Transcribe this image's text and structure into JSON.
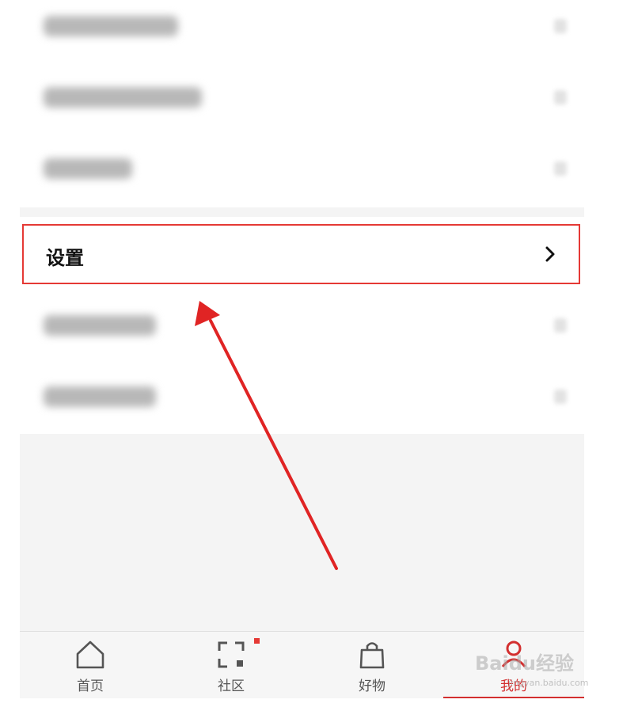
{
  "settings": {
    "label": "设置"
  },
  "tabbar": {
    "tabs": [
      {
        "label": "首页",
        "icon": "home-icon"
      },
      {
        "label": "社区",
        "icon": "community-icon"
      },
      {
        "label": "好物",
        "icon": "shopping-bag-icon"
      },
      {
        "label": "我的",
        "icon": "profile-icon",
        "active": true
      }
    ]
  },
  "watermark": {
    "text": "Baidu经验",
    "sub": "jingyan.baidu.com"
  },
  "colors": {
    "accent": "#d32f2f",
    "highlight_box": "#e53935"
  }
}
